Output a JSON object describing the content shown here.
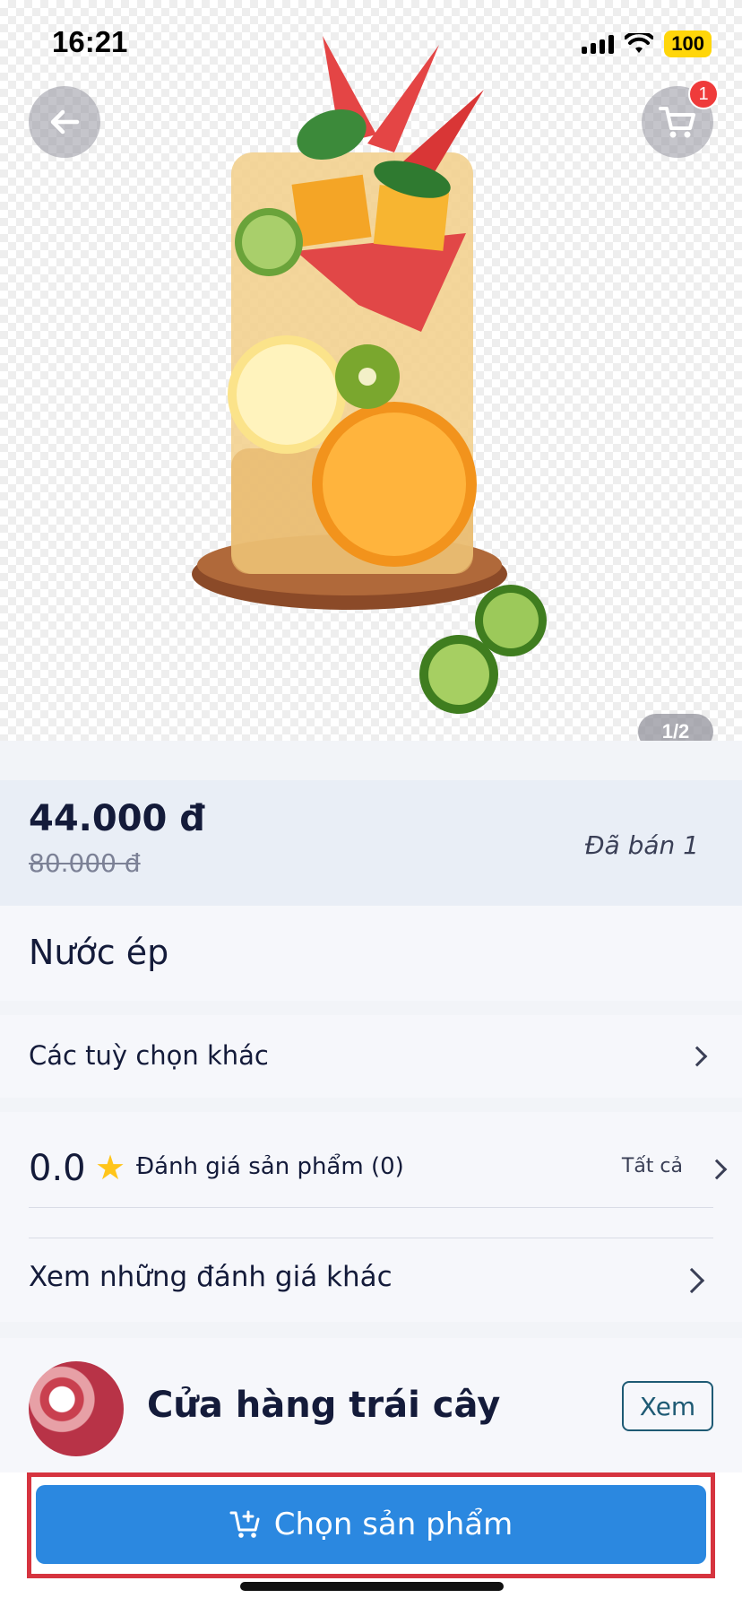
{
  "status_bar": {
    "time": "16:21",
    "battery": "100"
  },
  "hero": {
    "pager": "1/2",
    "cart_count": "1"
  },
  "price": {
    "current": "44.000 đ",
    "original": "80.000 đ",
    "sold": "Đã bán 1"
  },
  "product": {
    "name": "Nước ép"
  },
  "options": {
    "label": "Các tuỳ chọn khác"
  },
  "reviews": {
    "rating": "0.0",
    "label": "Đánh giá sản phẩm (0)",
    "see_all": "Tất cả",
    "more_label": "Xem những đánh giá khác"
  },
  "shop": {
    "name": "Cửa hàng trái cây",
    "view_label": "Xem"
  },
  "cta": {
    "label": "Chọn sản phẩm"
  },
  "colors": {
    "primary": "#2b88e0",
    "badge": "#ef3b3b",
    "star": "#ffc51a",
    "highlight": "#d6343f"
  },
  "icons": [
    "back-arrow-icon",
    "cart-icon",
    "signal-icon",
    "wifi-icon",
    "star-icon",
    "chevron-right-icon",
    "cart-add-icon"
  ]
}
